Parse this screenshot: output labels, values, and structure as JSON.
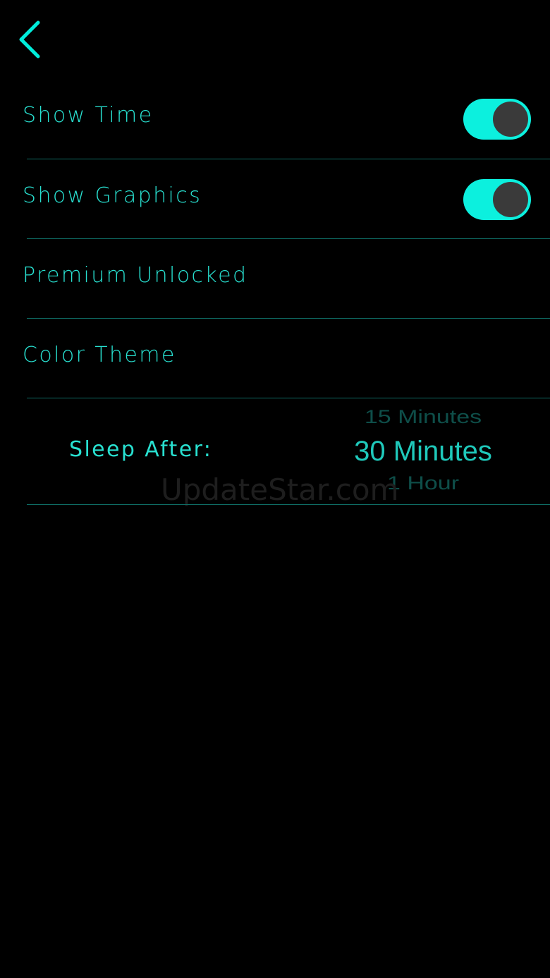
{
  "colors": {
    "background": "#000000",
    "accent": "#00eddb",
    "label_text": "#28e0d0",
    "divider": "#0e6b63",
    "toggle_on": "#0cf0de",
    "toggle_knob": "#3a3a3a",
    "picker_selected": "#1fc9bb",
    "picker_dim": "#1a8f86"
  },
  "header": {
    "back_icon": "chevron-left-icon"
  },
  "settings": {
    "show_time": {
      "label": "Show Time",
      "enabled": true
    },
    "show_graphics": {
      "label": "Show Graphics",
      "enabled": true
    },
    "premium": {
      "label": "Premium Unlocked"
    },
    "color_theme": {
      "label": "Color Theme"
    }
  },
  "sleep": {
    "label": "Sleep After:",
    "options": {
      "prev": "15 Minutes",
      "selected": "30 Minutes",
      "next": "1 Hour"
    }
  },
  "watermark": "UpdateStar.com"
}
